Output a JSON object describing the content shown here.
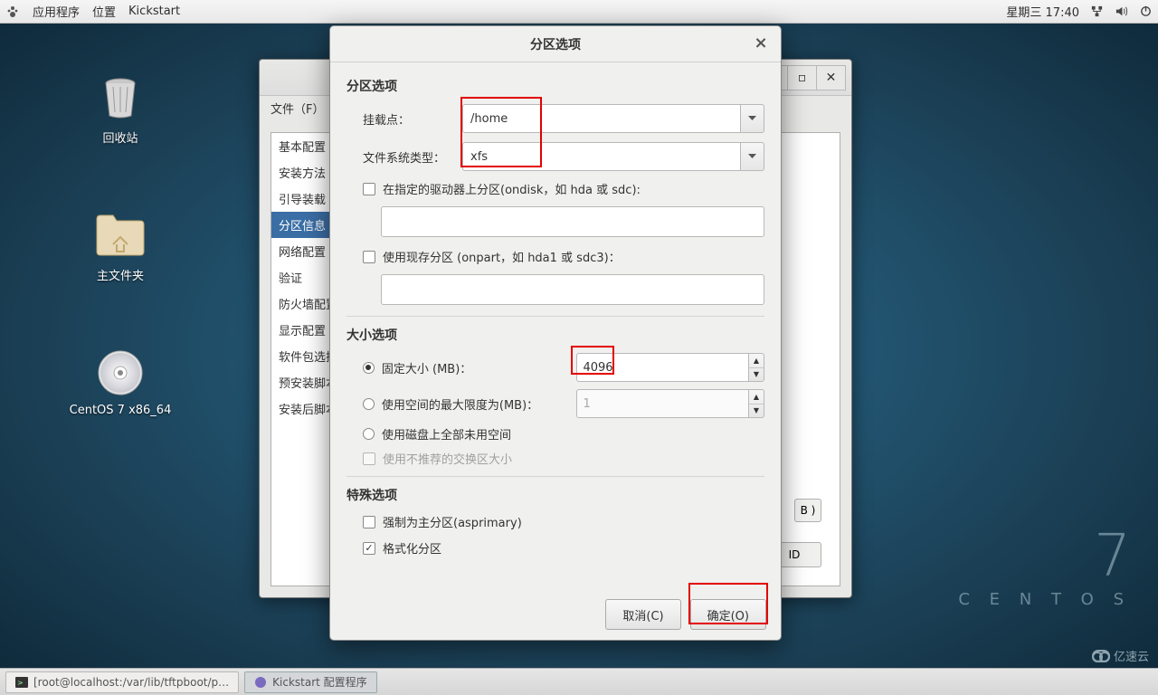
{
  "topbar": {
    "apps": "应用程序",
    "places": "位置",
    "app_name": "Kickstart",
    "date": "星期三 17:40"
  },
  "desktop": {
    "trash": "回收站",
    "home": "主文件夹",
    "media": "CentOS 7 x86_64"
  },
  "centos": {
    "seven": "7",
    "name": "C E N T O S"
  },
  "kick_window": {
    "menu_file": "文件（F）",
    "sidebar": {
      "items": [
        "基本配置",
        "安装方法",
        "引导装载",
        "分区信息",
        "网络配置",
        "验证",
        "防火墙配置",
        "显示配置",
        "软件包选择",
        "预安装脚本",
        "安装后脚本"
      ],
      "selected_index": 3
    },
    "hint_b": "B )",
    "raid": "ID"
  },
  "dialog": {
    "title": "分区选项",
    "section_partition": "分区选项",
    "mount_label": "挂载点：",
    "mount_value": "/home",
    "fs_label": "文件系统类型：",
    "fs_value": "xfs",
    "ondisk_label": "在指定的驱动器上分区(ondisk，如 hda 或 sdc):",
    "onpart_label": "使用现存分区 (onpart，如 hda1 或 sdc3)：",
    "section_size": "大小选项",
    "fixed_label": "固定大小 (MB)：",
    "fixed_value": "4096",
    "max_label": "使用空间的最大限度为(MB)：",
    "max_value": "1",
    "fill_label": "使用磁盘上全部未用空间",
    "swap_label": "使用不推荐的交换区大小",
    "section_special": "特殊选项",
    "asprimary_label": "强制为主分区(asprimary)",
    "format_label": "格式化分区",
    "cancel": "取消(C)",
    "ok": "确定(O)"
  },
  "taskbar": {
    "term": "[root@localhost:/var/lib/tftpboot/p…",
    "kick": "Kickstart 配置程序"
  },
  "watermark": "亿速云"
}
